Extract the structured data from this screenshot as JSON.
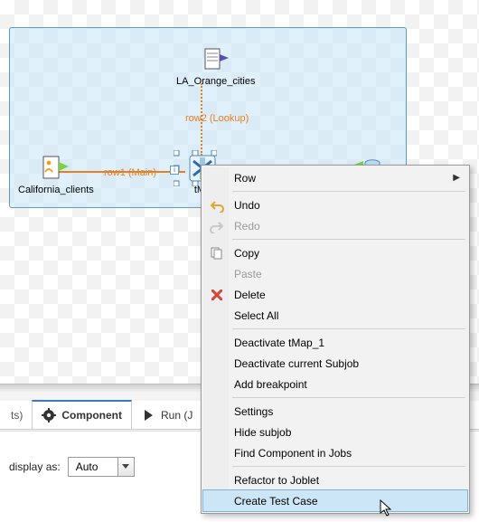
{
  "canvas": {
    "nodes": {
      "california": "California_clients",
      "la": "LA_Orange_cities",
      "tmap": "tMa",
      "out": ""
    },
    "connections": {
      "row1": "row1 (Main)",
      "row2": "row2 (Lookup)"
    }
  },
  "tabs": {
    "left_trunc": "ts)",
    "component": "Component",
    "run_trunc": "Run (J"
  },
  "properties": {
    "display_as_label": "display as:",
    "display_as_value": "Auto"
  },
  "context_menu": {
    "row": "Row",
    "undo": "Undo",
    "redo": "Redo",
    "copy": "Copy",
    "paste": "Paste",
    "delete": "Delete",
    "select_all": "Select All",
    "deactivate_tmap": "Deactivate tMap_1",
    "deactivate_subjob": "Deactivate current Subjob",
    "add_breakpoint": "Add breakpoint",
    "settings": "Settings",
    "hide_subjob": "Hide subjob",
    "find_component": "Find Component in Jobs",
    "refactor": "Refactor to Joblet",
    "create_test": "Create Test Case"
  }
}
